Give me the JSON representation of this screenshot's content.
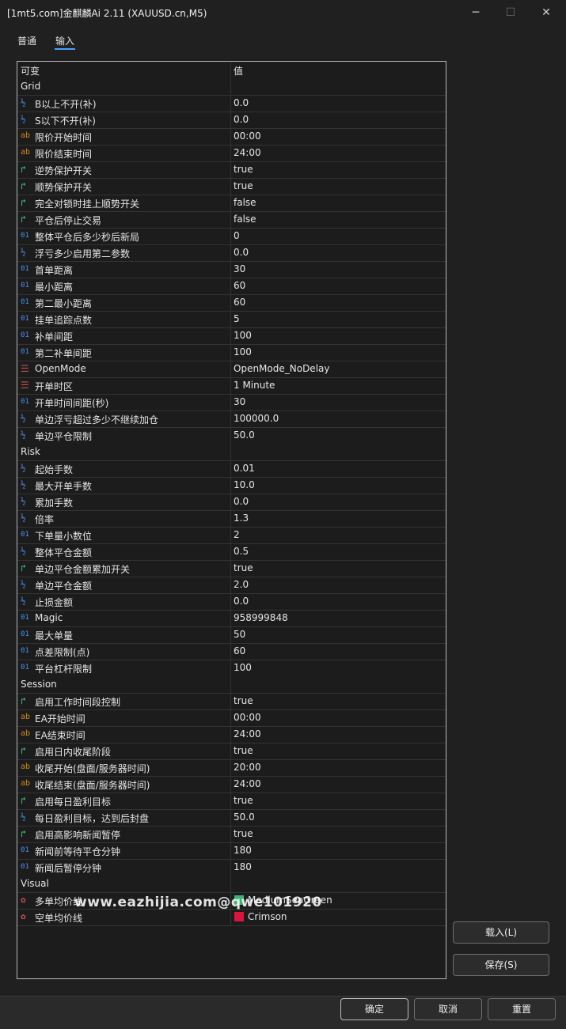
{
  "window": {
    "title": "[1mt5.com]金麒麟Ai 2.11 (XAUUSD.cn,M5)",
    "minimize_glyph": "─",
    "maximize_glyph": "☐",
    "close_glyph": "✕"
  },
  "tabs": [
    {
      "label": "普通",
      "active": false
    },
    {
      "label": "输入",
      "active": true
    }
  ],
  "table": {
    "headers": [
      "可变",
      "值"
    ],
    "rows": [
      {
        "kind": "section",
        "name": "Grid"
      },
      {
        "kind": "param",
        "icon": "fraction-icon",
        "name": "B以上不开(补)",
        "value": "0.0"
      },
      {
        "kind": "param",
        "icon": "fraction-icon",
        "name": "S以下不开(补)",
        "value": "0.0"
      },
      {
        "kind": "param",
        "icon": "string-icon",
        "name": "限价开始时间",
        "value": "00:00"
      },
      {
        "kind": "param",
        "icon": "string-icon",
        "name": "限价结束时间",
        "value": "24:00"
      },
      {
        "kind": "param",
        "icon": "bool-icon",
        "name": "逆势保护开关",
        "value": "true"
      },
      {
        "kind": "param",
        "icon": "bool-icon",
        "name": "顺势保护开关",
        "value": "true"
      },
      {
        "kind": "param",
        "icon": "bool-icon",
        "name": "完全对锁时挂上顺势开关",
        "value": "false"
      },
      {
        "kind": "param",
        "icon": "bool-icon",
        "name": "平仓后停止交易",
        "value": "false"
      },
      {
        "kind": "param",
        "icon": "int-icon",
        "name": "整体平仓后多少秒后新局",
        "value": "0"
      },
      {
        "kind": "param",
        "icon": "fraction-icon",
        "name": "浮亏多少启用第二参数",
        "value": "0.0"
      },
      {
        "kind": "param",
        "icon": "int-icon",
        "name": "首单距离",
        "value": "30"
      },
      {
        "kind": "param",
        "icon": "int-icon",
        "name": "最小距离",
        "value": "60"
      },
      {
        "kind": "param",
        "icon": "int-icon",
        "name": "第二最小距离",
        "value": "60"
      },
      {
        "kind": "param",
        "icon": "int-icon",
        "name": "挂单追踪点数",
        "value": "5"
      },
      {
        "kind": "param",
        "icon": "int-icon",
        "name": "补单间距",
        "value": "100"
      },
      {
        "kind": "param",
        "icon": "int-icon",
        "name": "第二补单间距",
        "value": "100"
      },
      {
        "kind": "param",
        "icon": "enum-icon",
        "name": "OpenMode",
        "value": "OpenMode_NoDelay"
      },
      {
        "kind": "param",
        "icon": "enum-icon",
        "name": "开单时区",
        "value": "1 Minute"
      },
      {
        "kind": "param",
        "icon": "int-icon",
        "name": "开单时间间距(秒)",
        "value": "30"
      },
      {
        "kind": "param",
        "icon": "fraction-icon",
        "name": "单边浮亏超过多少不继续加仓",
        "value": "100000.0"
      },
      {
        "kind": "param",
        "icon": "fraction-icon",
        "name": "单边平仓限制",
        "value": "50.0"
      },
      {
        "kind": "section",
        "name": "Risk"
      },
      {
        "kind": "param",
        "icon": "fraction-icon",
        "name": "起始手数",
        "value": "0.01"
      },
      {
        "kind": "param",
        "icon": "fraction-icon",
        "name": "最大开单手数",
        "value": "10.0"
      },
      {
        "kind": "param",
        "icon": "fraction-icon",
        "name": "累加手数",
        "value": "0.0"
      },
      {
        "kind": "param",
        "icon": "fraction-icon",
        "name": "倍率",
        "value": "1.3"
      },
      {
        "kind": "param",
        "icon": "int-icon",
        "name": "下单量小数位",
        "value": "2"
      },
      {
        "kind": "param",
        "icon": "fraction-icon",
        "name": "整体平仓金额",
        "value": "0.5"
      },
      {
        "kind": "param",
        "icon": "bool-icon",
        "name": "单边平仓金额累加开关",
        "value": "true"
      },
      {
        "kind": "param",
        "icon": "fraction-icon",
        "name": "单边平仓金额",
        "value": "2.0"
      },
      {
        "kind": "param",
        "icon": "fraction-icon",
        "name": "止损金额",
        "value": "0.0"
      },
      {
        "kind": "param",
        "icon": "int-icon",
        "name": "Magic",
        "value": "958999848"
      },
      {
        "kind": "param",
        "icon": "int-icon",
        "name": "最大单量",
        "value": "50"
      },
      {
        "kind": "param",
        "icon": "int-icon",
        "name": "点差限制(点)",
        "value": "60"
      },
      {
        "kind": "param",
        "icon": "int-icon",
        "name": "平台杠杆限制",
        "value": "100"
      },
      {
        "kind": "section",
        "name": "Session"
      },
      {
        "kind": "param",
        "icon": "bool-icon",
        "name": "启用工作时间段控制",
        "value": "true"
      },
      {
        "kind": "param",
        "icon": "string-icon",
        "name": "EA开始时间",
        "value": "00:00"
      },
      {
        "kind": "param",
        "icon": "string-icon",
        "name": "EA结束时间",
        "value": "24:00"
      },
      {
        "kind": "param",
        "icon": "bool-icon",
        "name": "启用日内收尾阶段",
        "value": "true"
      },
      {
        "kind": "param",
        "icon": "string-icon",
        "name": "收尾开始(盘面/服务器时间)",
        "value": "20:00"
      },
      {
        "kind": "param",
        "icon": "string-icon",
        "name": "收尾结束(盘面/服务器时间)",
        "value": "24:00"
      },
      {
        "kind": "param",
        "icon": "bool-icon",
        "name": "启用每日盈利目标",
        "value": "true"
      },
      {
        "kind": "param",
        "icon": "fraction-icon",
        "name": "每日盈利目标，达到后封盘",
        "value": "50.0"
      },
      {
        "kind": "param",
        "icon": "bool-icon",
        "name": "启用高影响新闻暂停",
        "value": "true"
      },
      {
        "kind": "param",
        "icon": "int-icon",
        "name": "新闻前等待平仓分钟",
        "value": "180"
      },
      {
        "kind": "param",
        "icon": "int-icon",
        "name": "新闻后暂停分钟",
        "value": "180"
      },
      {
        "kind": "section",
        "name": "Visual"
      },
      {
        "kind": "param",
        "icon": "color-icon",
        "name": "多单均价线",
        "value": "MediumSeaGreen",
        "swatch": "#3cb371"
      },
      {
        "kind": "param",
        "icon": "color-icon",
        "name": "空单均价线",
        "value": "Crimson",
        "swatch": "#dc143c"
      }
    ]
  },
  "watermark": "www.eazhijia.com@qwe101920",
  "icon_glyphs": {
    "fraction-icon": "½",
    "string-icon": "ab",
    "int-icon": "01",
    "bool-icon": "↱",
    "enum-icon": "☰",
    "color-icon": "✿"
  },
  "side_buttons": {
    "load": "载入(L)",
    "save": "保存(S)"
  },
  "footer_buttons": {
    "ok": "确定",
    "cancel": "取消",
    "reset": "重置"
  }
}
